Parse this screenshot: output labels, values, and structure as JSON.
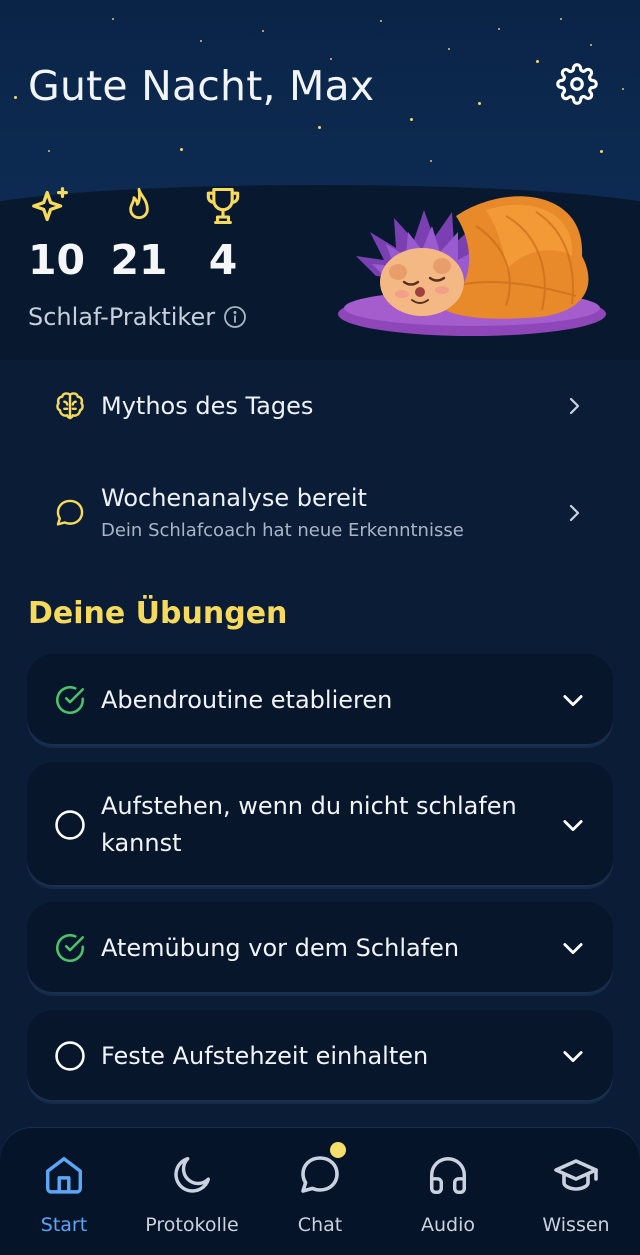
{
  "header": {
    "greeting": "Gute Nacht, Max",
    "settings_icon": "gear-icon"
  },
  "stats": [
    {
      "icon": "sparkles-icon",
      "value": "10"
    },
    {
      "icon": "flame-icon",
      "value": "21"
    },
    {
      "icon": "trophy-icon",
      "value": "4"
    }
  ],
  "level": {
    "label": "Schlaf-Praktiker",
    "icon": "info-icon"
  },
  "mascot": {
    "icon": "sleeping-hedgehog-illustration"
  },
  "links": [
    {
      "icon": "brain-icon",
      "title": "Mythos des Tages",
      "subtitle": ""
    },
    {
      "icon": "chat-bubble-icon",
      "title": "Wochenanalyse bereit",
      "subtitle": "Dein Schlafcoach hat neue Erkenntnisse"
    }
  ],
  "section": {
    "title": "Deine Übungen"
  },
  "exercises": [
    {
      "label": "Abendroutine etablieren",
      "done": true
    },
    {
      "label": "Aufstehen, wenn du nicht schlafen kannst",
      "done": false
    },
    {
      "label": "Atemübung vor dem Schlafen",
      "done": true
    },
    {
      "label": "Feste Aufstehzeit einhalten",
      "done": false
    }
  ],
  "tabs": [
    {
      "label": "Start",
      "icon": "home-icon",
      "active": true
    },
    {
      "label": "Protokolle",
      "icon": "moon-icon",
      "active": false
    },
    {
      "label": "Chat",
      "icon": "chat-icon",
      "active": false,
      "badge": true
    },
    {
      "label": "Audio",
      "icon": "headphones-icon",
      "active": false
    },
    {
      "label": "Wissen",
      "icon": "graduation-cap-icon",
      "active": false
    }
  ],
  "colors": {
    "accent_yellow": "#f7da5a",
    "check_green": "#4cc26a",
    "active_blue": "#5aa8f5",
    "background": "#0b1d36"
  }
}
